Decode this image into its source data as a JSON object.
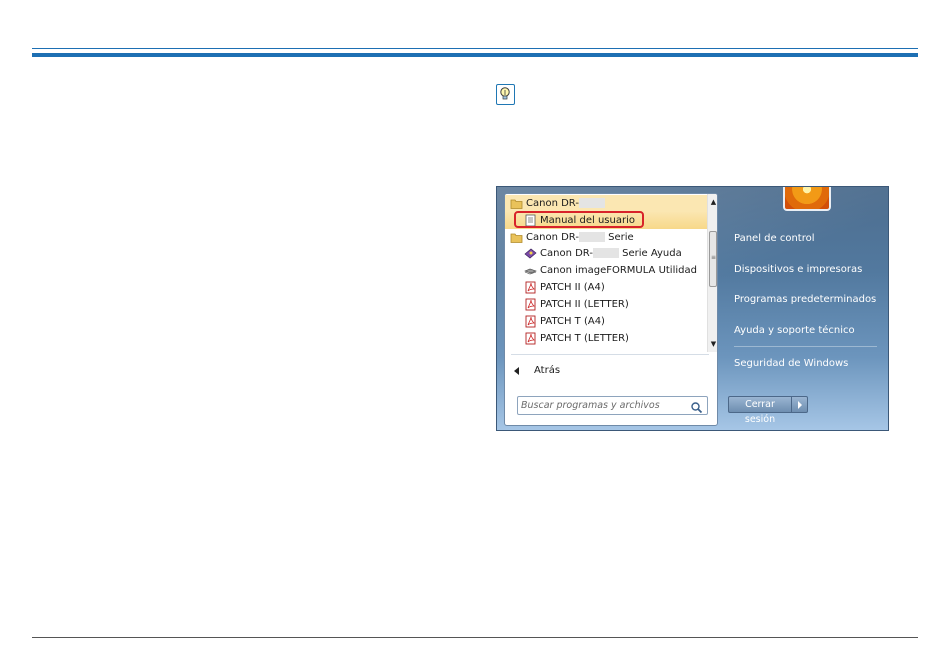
{
  "startmenu": {
    "programs": [
      {
        "label": "Canon DR-",
        "icon": "folder-icon",
        "state": "selected"
      },
      {
        "label": "Manual del usuario",
        "icon": "document-icon",
        "state": "highlighted"
      },
      {
        "label": "Canon DR-",
        "suffix": "Serie",
        "icon": "folder-icon",
        "state": "normal"
      },
      {
        "label": "Canon DR-",
        "suffix": "Serie Ayuda",
        "icon": "help-book-icon",
        "state": "normal"
      },
      {
        "label": "Canon imageFORMULA Utilidad",
        "icon": "scanner-utility-icon",
        "state": "normal"
      },
      {
        "label": "PATCH II (A4)",
        "icon": "pdf-icon",
        "state": "normal"
      },
      {
        "label": "PATCH II (LETTER)",
        "icon": "pdf-icon",
        "state": "normal"
      },
      {
        "label": "PATCH T (A4)",
        "icon": "pdf-icon",
        "state": "normal"
      },
      {
        "label": "PATCH T (LETTER)",
        "icon": "pdf-icon",
        "state": "normal"
      }
    ],
    "back_label": "Atrás",
    "search_placeholder": "Buscar programas y archivos",
    "right_items": [
      "Panel de control",
      "Dispositivos e impresoras",
      "Programas predeterminados",
      "Ayuda y soporte técnico",
      "Seguridad de Windows"
    ],
    "shutdown_label": "Cerrar sesión"
  },
  "colors": {
    "rule": "#1d6fb3",
    "highlight_box": "#d8232a",
    "selection": "#fbe7b2"
  }
}
